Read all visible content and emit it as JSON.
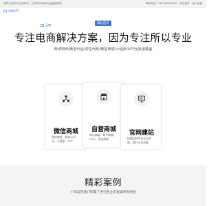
{
  "topbar": {
    "welcome": "您好,欢迎访问云商时代，云商时代电商代运营服务商！",
    "links": [
      "联系电话：188 8888 8888",
      "设为首页",
      "加入收藏"
    ]
  },
  "brand": {
    "logo_alt": "云商时代"
  },
  "hero": {
    "logo_alt": "云商",
    "nav_label": "网站首页",
    "title": "专注电商解决方案，因为专注所以专业",
    "subtitle": "商城电商/微信代运/淘宝代购/微信商城/小程序/APP全渠道覆盖"
  },
  "cards": [
    {
      "icon": "network-icon",
      "title": "微信商城",
      "desc": "微信商城、微信公众号、小程序、APP"
    },
    {
      "icon": "storefront-icon",
      "title": "自营商城",
      "desc": "单店商城、商户商城、O2O、多店商城"
    },
    {
      "icon": "monitor-icon",
      "title": "官网建站",
      "desc": "快速定制专业企业官网，提升企业形象"
    }
  ],
  "cases": {
    "title": "精彩案例",
    "subtitle": "十年运营我们积累了各行各业丰富案例和经验"
  }
}
